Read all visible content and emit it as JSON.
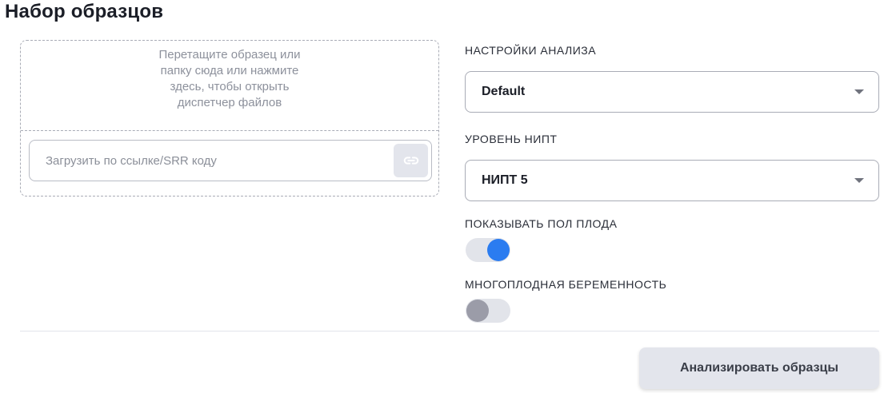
{
  "page": {
    "title": "Набор образцов"
  },
  "upload": {
    "hint": "Перетащите образец или папку сюда или нажмите здесь, чтобы открыть диспетчер файлов",
    "url_placeholder": "Загрузить по ссылке/SRR коду",
    "link_icon": "link-icon"
  },
  "settings": {
    "analysis_label": "НАСТРОЙКИ АНАЛИЗА",
    "analysis_value": "Default",
    "nipt_label": "УРОВЕНЬ НИПТ",
    "nipt_value": "НИПТ 5",
    "fetal_sex_label": "ПОКАЗЫВАТЬ ПОЛ ПЛОДА",
    "fetal_sex_enabled": true,
    "multiple_pregnancy_label": "МНОГОПЛОДНАЯ БЕРЕМЕННОСТЬ",
    "multiple_pregnancy_enabled": false
  },
  "actions": {
    "analyze_label": "Анализировать образцы"
  },
  "colors": {
    "toggle_on": "#2b7cf0",
    "toggle_off": "#9b9ca8",
    "button_bg": "#e3e5ec"
  }
}
